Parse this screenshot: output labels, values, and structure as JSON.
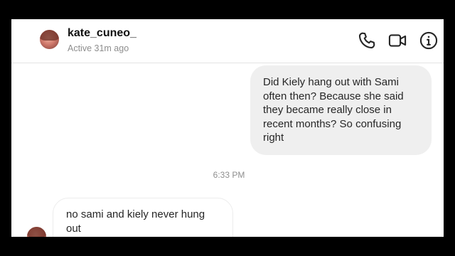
{
  "header": {
    "username": "kate_cuneo_",
    "status": "Active 31m ago",
    "icons": [
      "phone-icon",
      "video-camera-icon",
      "info-icon"
    ]
  },
  "messages": [
    {
      "direction": "outgoing",
      "text": "Did Kiely hang out with Sami often then? Because she said they became really close in recent months? So confusing right"
    },
    {
      "direction": "incoming",
      "text": "no sami and kiely never hung out"
    }
  ],
  "timestamp": "6:33 PM",
  "colors": {
    "outgoing_bubble": "#efefef",
    "incoming_bubble": "#ffffff",
    "secondary_text": "#8e8e8e",
    "primary_text": "#262626"
  }
}
